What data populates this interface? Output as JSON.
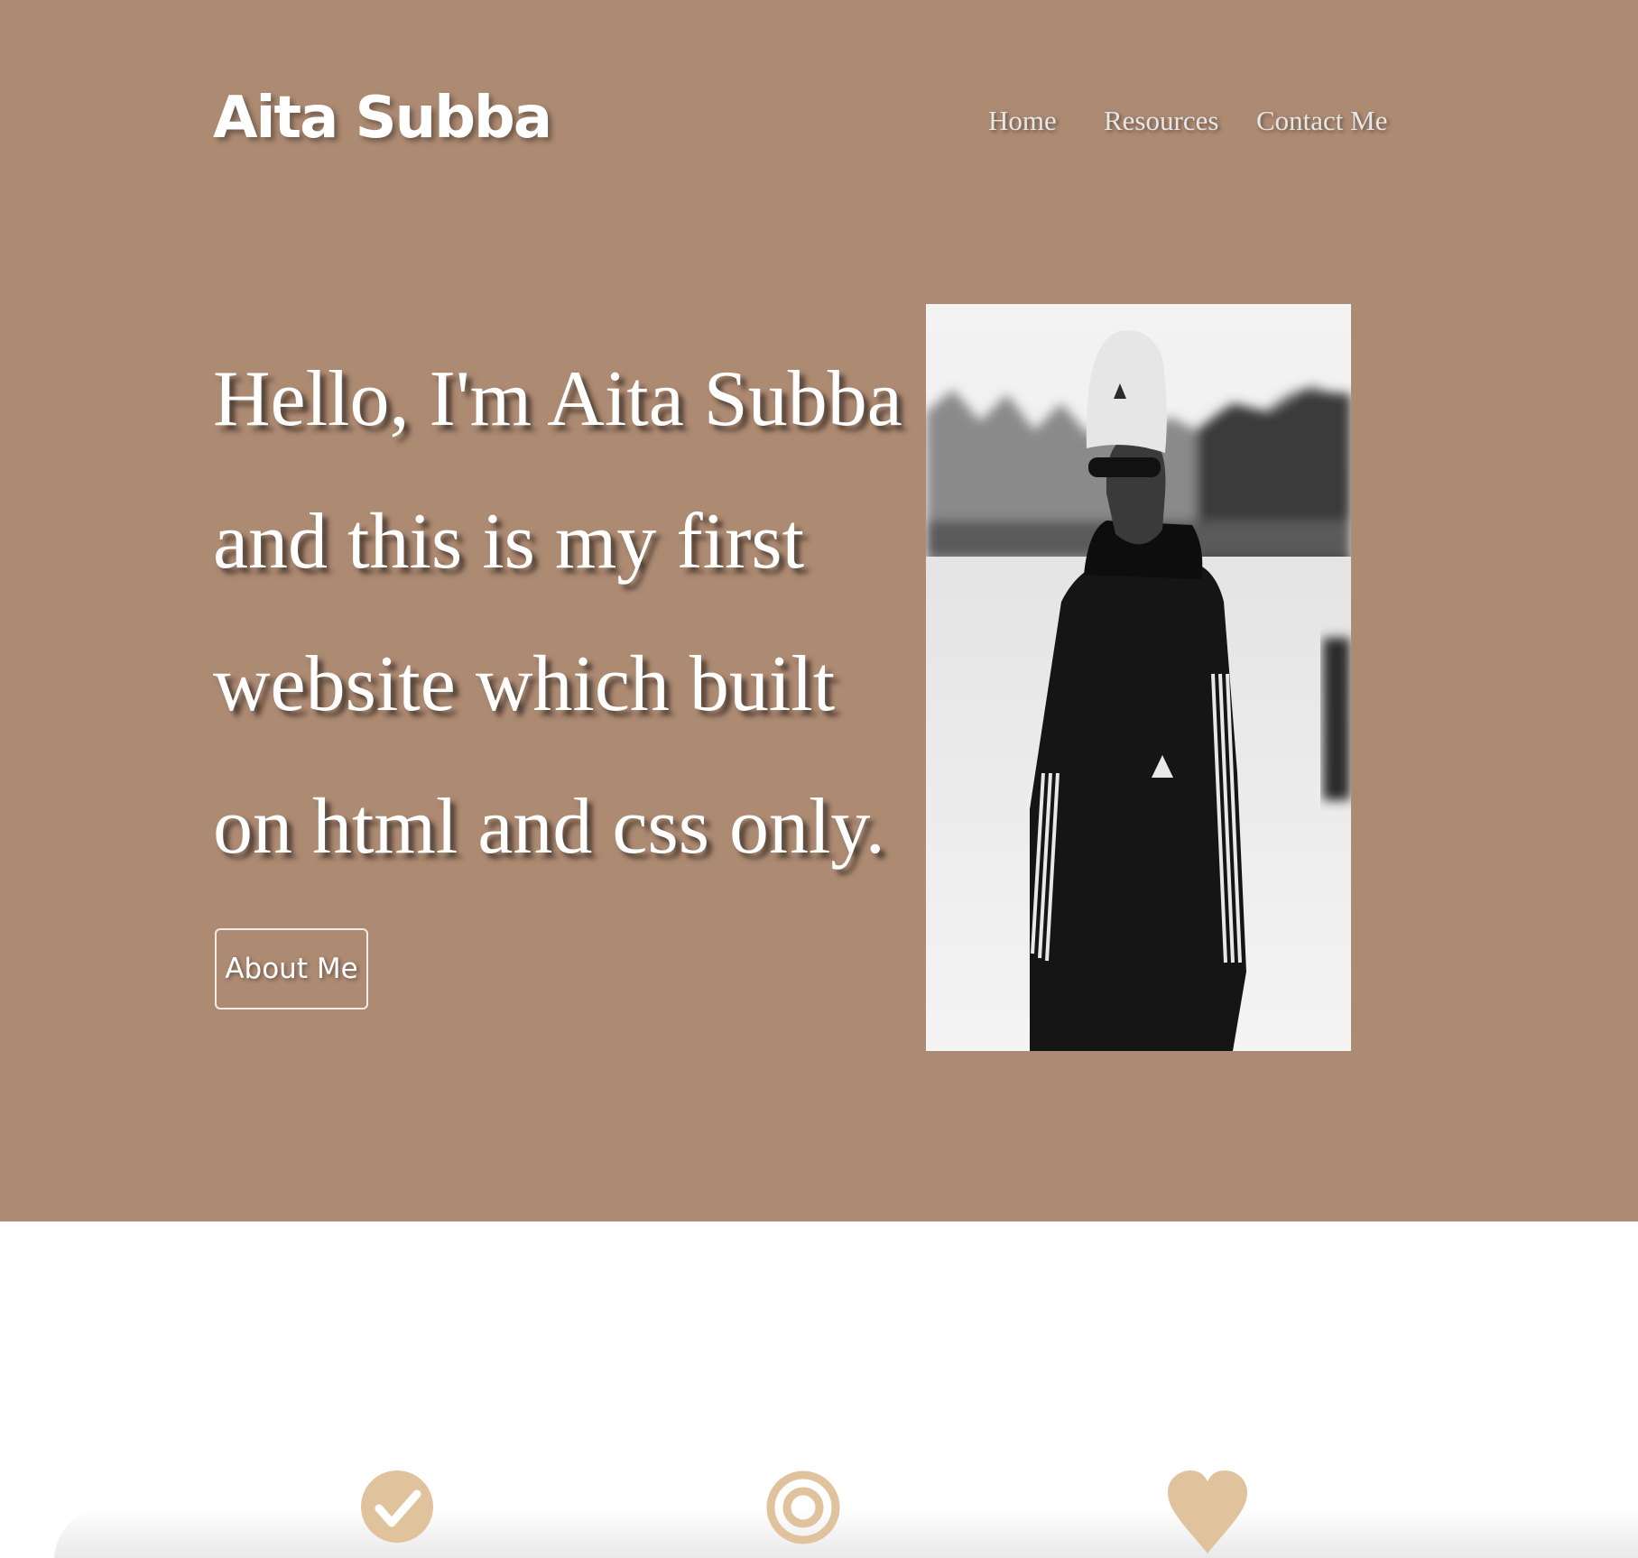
{
  "header": {
    "brand": "Aita Subba",
    "nav": [
      {
        "label": "Home"
      },
      {
        "label": "Resources"
      },
      {
        "label": "Contact Me"
      }
    ]
  },
  "hero": {
    "headline_lines": [
      "Hello, I'm Aita Subba",
      "and this is my first",
      "website which built",
      "on html and css only."
    ],
    "cta_label": "About Me",
    "photo_icon": "portrait-photo"
  },
  "features": {
    "icons": [
      "check-circle-icon",
      "target-icon",
      "heart-icon"
    ]
  },
  "colors": {
    "hero_background": "#ad8a72",
    "accent_icon": "#e0c39c",
    "page_background": "#ffffff",
    "text": "#ffffff"
  }
}
